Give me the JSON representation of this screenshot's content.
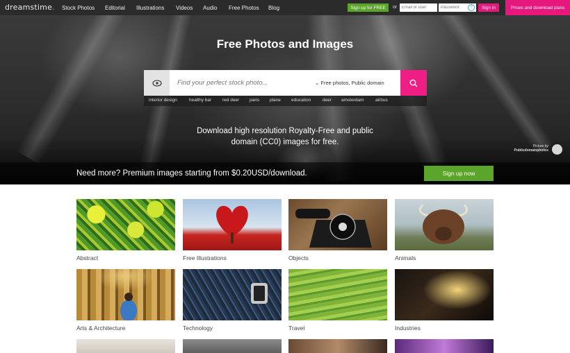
{
  "header": {
    "logo_text": "dreamstime",
    "nav": [
      "Stock Photos",
      "Editorial",
      "Illustrations",
      "Videos",
      "Audio",
      "Free Photos",
      "Blog"
    ],
    "signup_free_label": "Sign up for FREE",
    "or_label": "or",
    "email_placeholder": "Email or user",
    "password_placeholder": "Password",
    "help_icon": "?",
    "signin_label": "Sign in",
    "prices_label": "Prices and download plans"
  },
  "hero": {
    "title": "Free Photos and Images",
    "search_placeholder": "Find your perfect stock photo...",
    "filter_label": "Free photos, Public domain",
    "tags": [
      "interior design",
      "healthy bar",
      "red deer",
      "paris",
      "plane",
      "education",
      "deer",
      "amsterdam",
      "airbus"
    ],
    "subtitle_line1": "Download high resolution Royalty-Free and public",
    "subtitle_line2": "domain (CC0) images for free.",
    "credit_line1": "Picture by",
    "credit_line2": "Publicdomainphotos",
    "promo_text": "Need more? Premium images starting from $0.20USD/download.",
    "signup_now_label": "Sign up now"
  },
  "categories": [
    {
      "label": "Abstract"
    },
    {
      "label": "Free Illustrations"
    },
    {
      "label": "Objects"
    },
    {
      "label": "Animals"
    },
    {
      "label": "Arts & Architecture"
    },
    {
      "label": "Technology"
    },
    {
      "label": "Travel"
    },
    {
      "label": "Industries"
    }
  ],
  "colors": {
    "brand_pink": "#e6177d",
    "brand_green": "#5ba52b",
    "topbar": "#2b2b2b"
  }
}
